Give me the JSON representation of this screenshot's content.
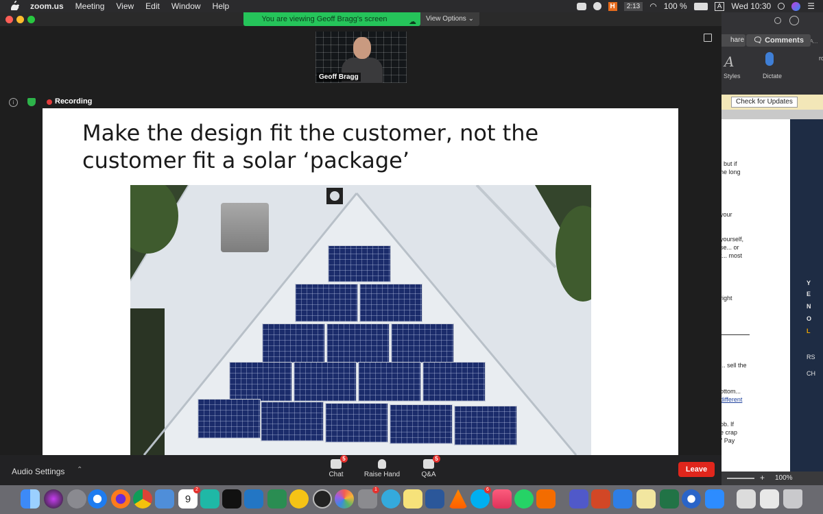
{
  "menubar": {
    "app_name": "zoom.us",
    "items": [
      "Meeting",
      "View",
      "Edit",
      "Window",
      "Help"
    ],
    "timer_badge": "H",
    "timer": "2:13",
    "battery": "100 %",
    "input_source": "A",
    "clock": "Wed 10:30"
  },
  "zoom": {
    "share_banner": "You are viewing Geoff Bragg's screen",
    "view_options": "View Options",
    "participant_name": "Geoff Bragg",
    "recording_label": "Recording",
    "toolbar": {
      "audio_settings": "Audio Settings",
      "chat": "Chat",
      "chat_count": "5",
      "raise_hand": "Raise Hand",
      "qa": "Q&A",
      "qa_count": "5",
      "leave": "Leave"
    }
  },
  "slide": {
    "title_line1": "Make the design fit the customer, not the",
    "title_line2": "customer fit a solar ‘package’"
  },
  "word": {
    "share_label": "hare",
    "comments_label": "Comments",
    "styles_label": "Styles",
    "dictate_label": "Dictate",
    "check_updates": "Check for Updates",
    "top_right_fragment": "he A...",
    "ribbon_fragment": "rd",
    "snippets": [
      ", but if",
      "he long",
      "your",
      " yourself,",
      "se... or",
      "t... most",
      "right",
      "... sell the",
      "ottom...",
      " different",
      "ob. If",
      "e crap",
      "\" Pay"
    ],
    "sidebar_letters": [
      "Y",
      "E",
      "N",
      "O",
      "L",
      "RS",
      "CH"
    ],
    "zoom_level": "100%"
  },
  "dock": {
    "calendar_day": "9",
    "calendar_badge": "2",
    "chat_app_badge": "1",
    "skype_badge": "6"
  }
}
